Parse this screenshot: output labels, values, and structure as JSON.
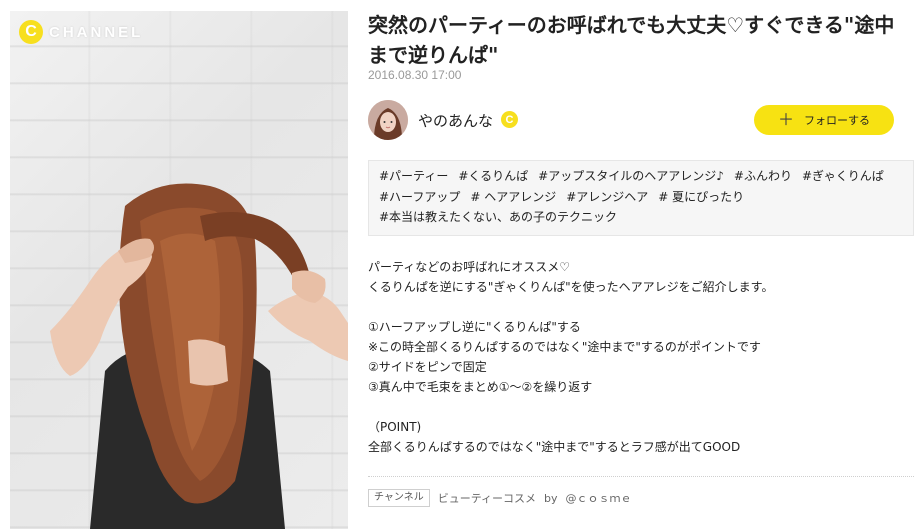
{
  "brand": {
    "letter": "C",
    "name": "CHANNEL"
  },
  "article": {
    "title": "突然のパーティーのお呼ばれでも大丈夫♡すぐできる\"途中まで逆りんぱ\"",
    "date": "2016.08.30 17:00",
    "author": {
      "name": "やのあんな",
      "badge": "C"
    },
    "follow_button": {
      "icon": "plus-icon",
      "label": "フォローする"
    },
    "tags": [
      "#パーティー",
      "#くるりんぱ",
      "#アップスタイルのヘアアレンジ♪",
      "#ふんわり",
      "#ぎゃくりんぱ",
      "#ハーフアップ",
      "# ヘアアレンジ",
      "#アレンジヘア",
      "# 夏にぴったり",
      "#本当は教えたくない、あの子のテクニック"
    ],
    "body": [
      "パーティなどのお呼ばれにオススメ♡",
      "くるりんぱを逆にする\"ぎゃくりんぱ\"を使ったヘアアレジをご紹介します。",
      "",
      "①ハーフアップし逆に\"くるりんぱ\"する",
      "※この時全部くるりんぱするのではなく\"途中まで\"するのがポイントです",
      "②サイドをピンで固定",
      "③真ん中で毛束をまとめ①〜②を繰り返す",
      "",
      "（POINT)",
      "全部くるりんぱするのではなく\"途中まで\"するとラフ感が出てGOOD"
    ],
    "footer": {
      "channel_label": "チャンネル",
      "category": "ビューティーコスメ",
      "by": "by",
      "source": "@ｃｏｓｍｅ"
    }
  },
  "colors": {
    "accent": "#f7e212",
    "brand_yellow": "#f7df1e",
    "muted": "#999999"
  }
}
